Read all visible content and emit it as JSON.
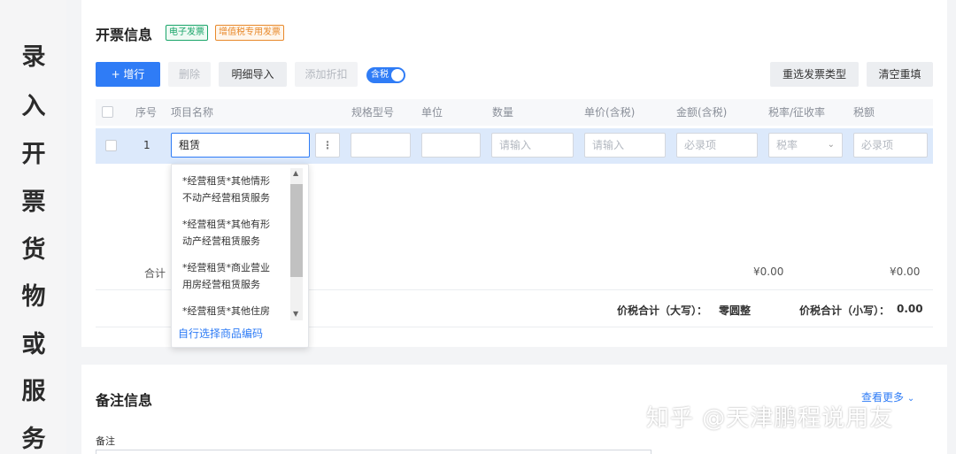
{
  "side_caption": [
    "录",
    "入",
    "开",
    "票",
    "货",
    "物",
    "或",
    "服",
    "务"
  ],
  "invoice": {
    "title": "开票信息",
    "tag_electronic": "电子发票",
    "tag_special": "增值税专用发票"
  },
  "toolbar": {
    "add_row": "+  增行",
    "delete": "删除",
    "detail_import": "明细导入",
    "add_discount": "添加折扣",
    "tax_included": "含税",
    "reselect_type": "重选发票类型",
    "clear_refill": "清空重填"
  },
  "table": {
    "headers": [
      "序号",
      "项目名称",
      "规格型号",
      "单位",
      "数量",
      "单价(含税)",
      "金额(含税)",
      "税率/征收率",
      "税额"
    ],
    "row": {
      "index": "1",
      "item_name": "租赁",
      "quantity_placeholder": "请输入",
      "price_placeholder": "请输入",
      "amount_placeholder": "必录项",
      "tax_rate_placeholder": "税率",
      "tax_amount_placeholder": "必录项"
    }
  },
  "summary": {
    "total_label": "合计",
    "amount_total": "¥0.00",
    "tax_total": "¥0.00",
    "upper_label": "价税合计（大写）：",
    "upper_value": "零圆整",
    "lower_label": "价税合计（小写）：",
    "lower_value": "0.00"
  },
  "dropdown": {
    "items": [
      [
        "*经营租赁*其他情形",
        "不动产经营租赁服务"
      ],
      [
        "*经营租赁*其他有形",
        "动产经营租赁服务"
      ],
      [
        "*经营租赁*商业营业",
        "用房经营租赁服务"
      ],
      [
        "*经营租赁*其他住房"
      ]
    ],
    "custom_link": "自行选择商品编码"
  },
  "remarks": {
    "title": "备注信息",
    "field_label": "备注",
    "more_link": "查看更多"
  },
  "watermark": "知乎 @天津鹏程说用友",
  "colors": {
    "primary": "#2f7cf6",
    "row_highlight": "#dce9fb",
    "tag_green": "#1aa56a",
    "tag_orange": "#e8892b"
  }
}
